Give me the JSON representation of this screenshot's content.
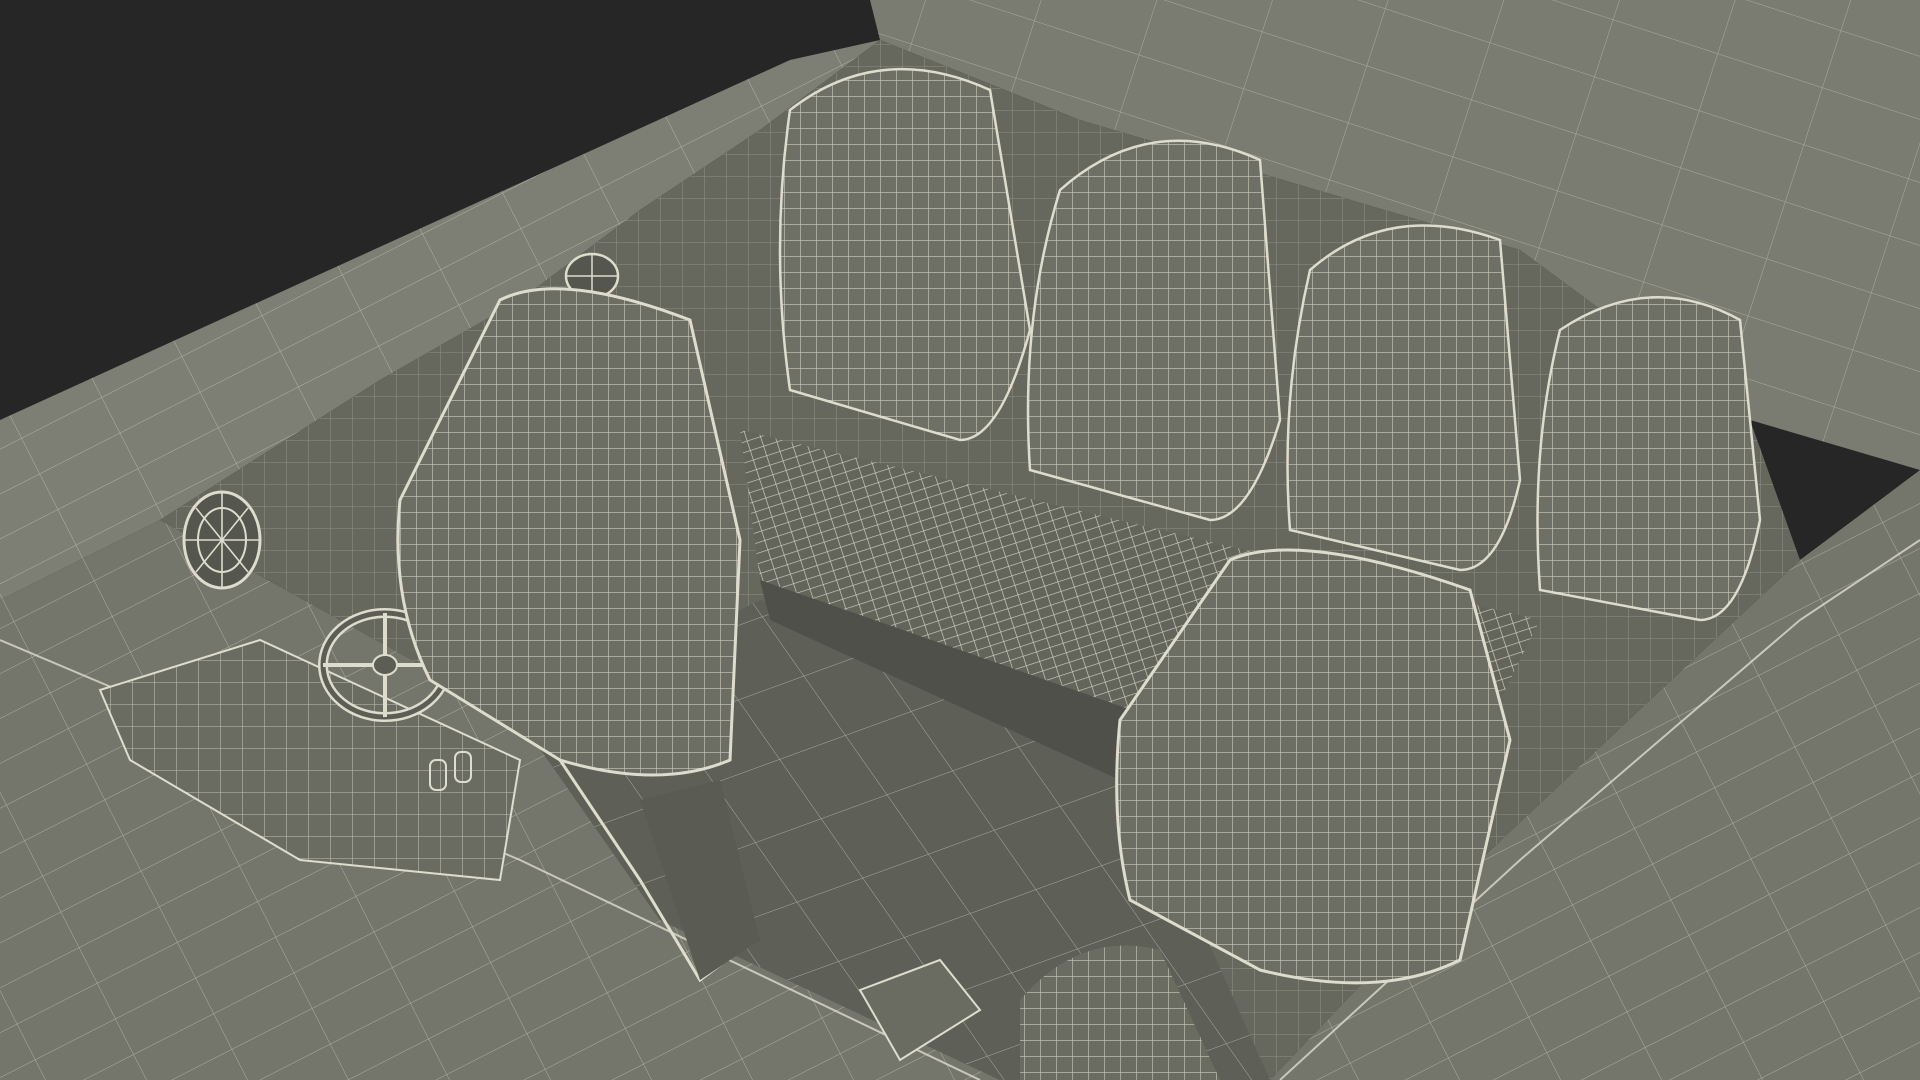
{
  "scene": {
    "subject": "boat-cockpit-wireframe-render",
    "colors": {
      "background": "#262626",
      "surface": "#72746a",
      "surface_dark": "#5c5e55",
      "surface_light": "#84867b",
      "wire": "#dedccd",
      "shadow": "#45463f"
    },
    "objects": [
      {
        "id": "hull-deck",
        "kind": "hull"
      },
      {
        "id": "rear-bench-seat",
        "kind": "bench"
      },
      {
        "id": "rear-backrest-1",
        "kind": "backrest"
      },
      {
        "id": "rear-backrest-2",
        "kind": "backrest"
      },
      {
        "id": "rear-backrest-3",
        "kind": "backrest"
      },
      {
        "id": "rear-backrest-4",
        "kind": "backrest"
      },
      {
        "id": "driver-seat",
        "kind": "bucket-seat"
      },
      {
        "id": "passenger-seat",
        "kind": "bucket-seat"
      },
      {
        "id": "steering-wheel",
        "kind": "wheel"
      },
      {
        "id": "speaker-left",
        "kind": "speaker"
      },
      {
        "id": "speaker-rear",
        "kind": "speaker"
      },
      {
        "id": "dashboard-console",
        "kind": "console"
      },
      {
        "id": "cockpit-floor",
        "kind": "floor"
      }
    ]
  }
}
